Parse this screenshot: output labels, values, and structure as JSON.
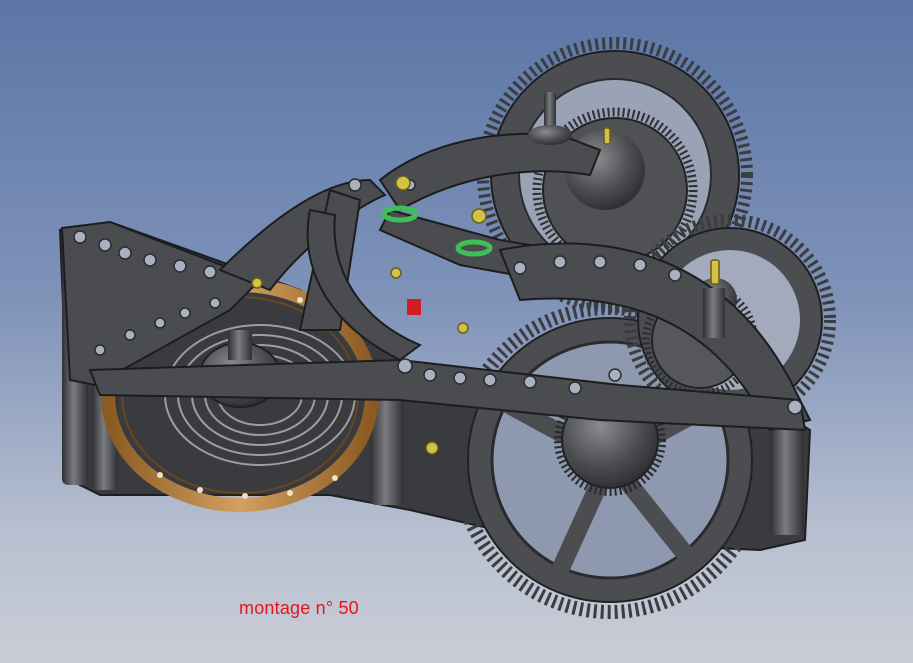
{
  "caption": {
    "text": "montage n° 50",
    "color": "#e8141c"
  },
  "scene": {
    "subject": "watch-movement-assembly",
    "background_top": "#5b76a6",
    "background_bottom": "#c9cdd6",
    "metal_color": "#4b4d51",
    "balance_ring_color": "#b07a35",
    "screw_color": "#d2c24a",
    "spacer_color": "#3fbf55",
    "marker_color": "#d11f1f"
  }
}
